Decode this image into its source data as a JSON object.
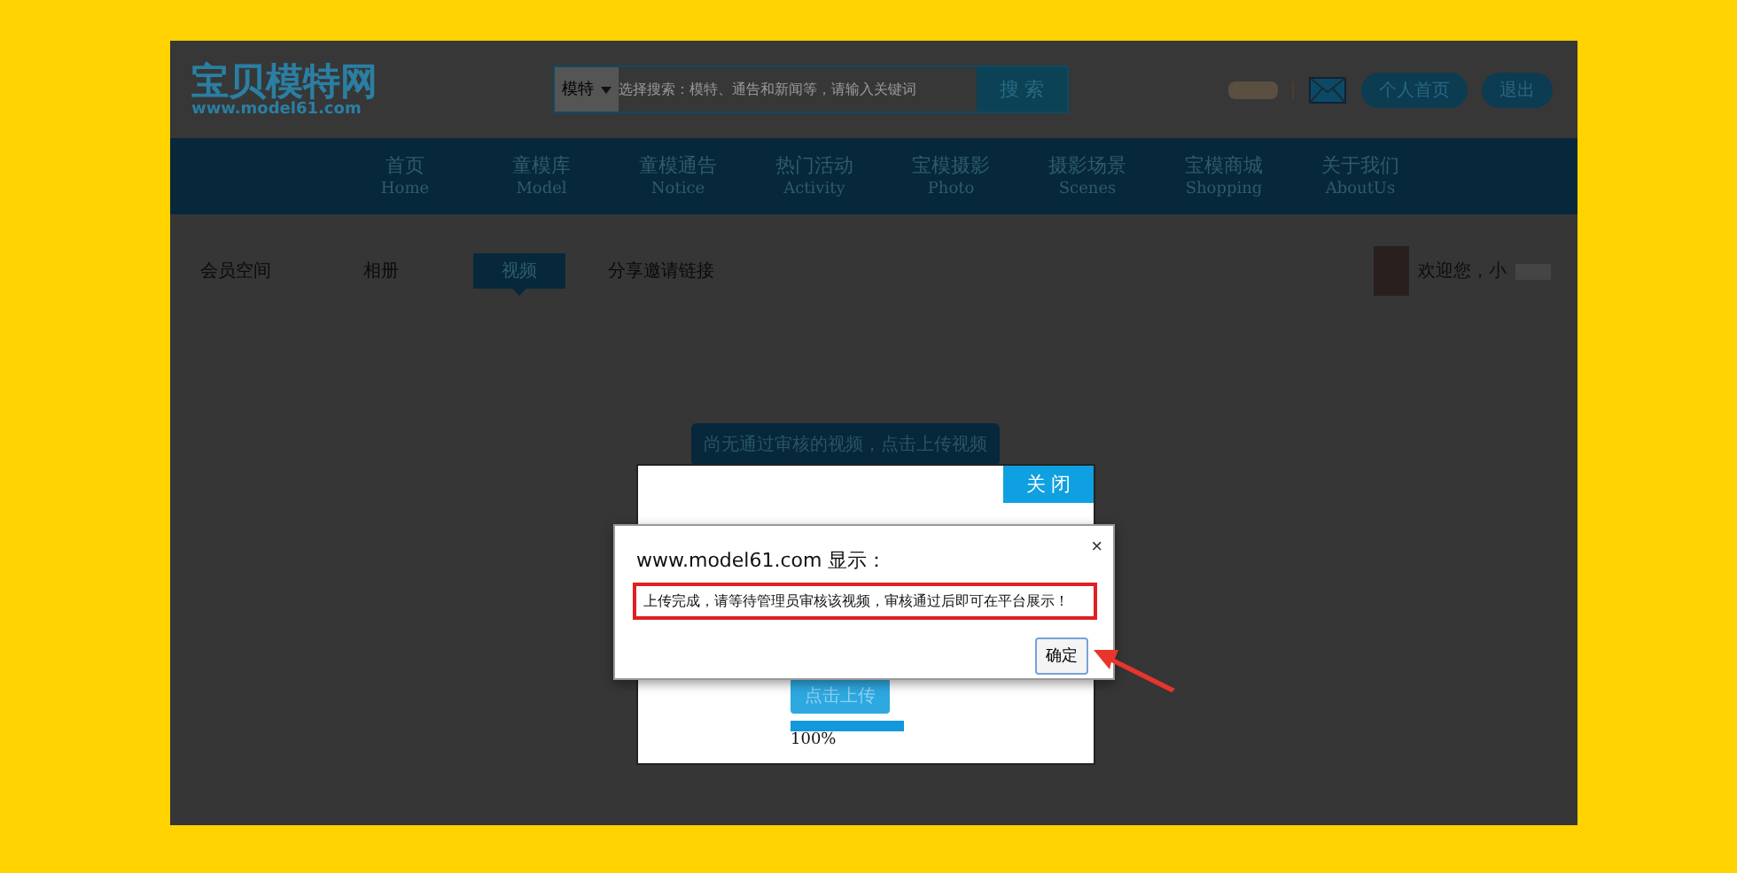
{
  "header": {
    "logo": {
      "title": "宝贝模特网",
      "url": "www.model61.com"
    },
    "search": {
      "category": "模特",
      "placeholder": "选择搜索：模特、通告和新闻等，请输入关键词",
      "button": "搜 索"
    },
    "links": [
      "个人首页",
      "退出"
    ]
  },
  "nav": [
    {
      "label": "首页",
      "en": "Home"
    },
    {
      "label": "童模库",
      "en": "Model"
    },
    {
      "label": "童模通告",
      "en": "Notice"
    },
    {
      "label": "热门活动",
      "en": "Activity"
    },
    {
      "label": "宝模摄影",
      "en": "Photo"
    },
    {
      "label": "摄影场景",
      "en": "Scenes"
    },
    {
      "label": "宝模商城",
      "en": "Shopping"
    },
    {
      "label": "关于我们",
      "en": "AboutUs"
    }
  ],
  "tabs": [
    {
      "label": "会员空间",
      "selected": false
    },
    {
      "label": "相册",
      "selected": false
    },
    {
      "label": "视频",
      "selected": true
    },
    {
      "label": "分享邀请链接",
      "selected": false
    }
  ],
  "welcome": "欢迎您，小",
  "notice_button": "尚无通过审核的视频，点击上传视频",
  "upload_dialog": {
    "close": "关 闭",
    "upload_button": "点击上传",
    "progress": {
      "level": 1,
      "reading": "100%"
    }
  },
  "alert": {
    "title": "www.model61.com 显示：",
    "close": "×",
    "message": "上传完成，请等待管理员审核该视频，审核通过后即可在平台展示！",
    "ok": "确定"
  }
}
